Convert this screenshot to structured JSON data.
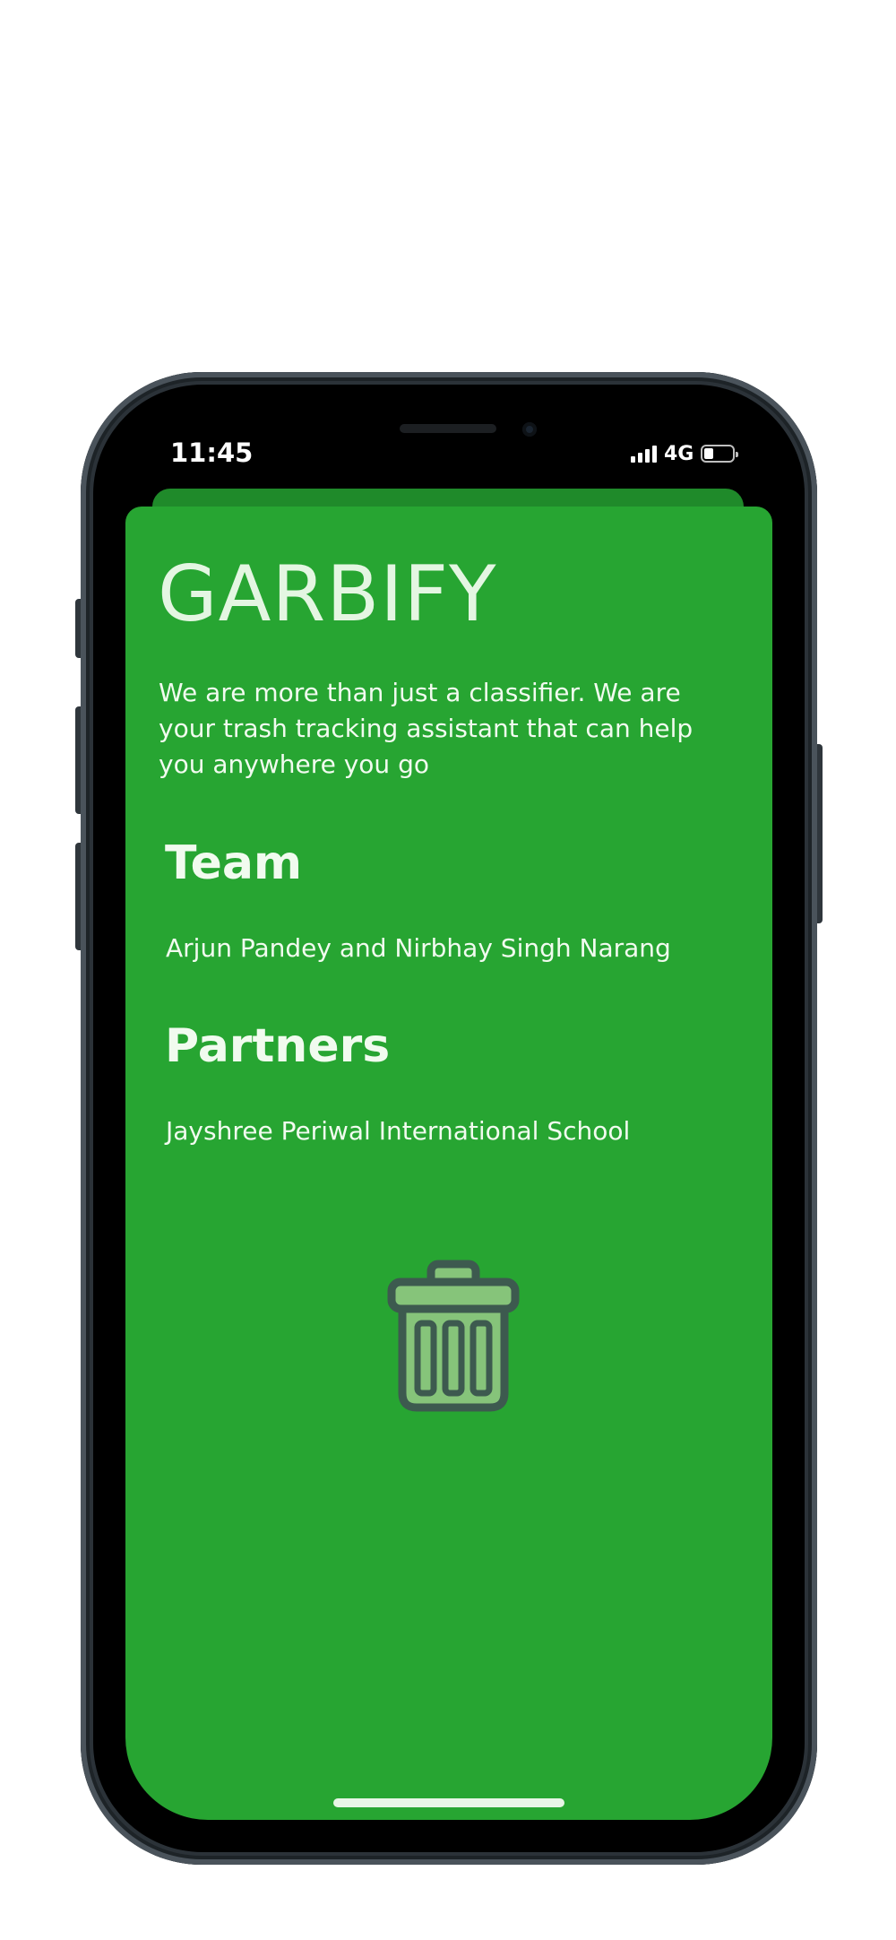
{
  "status_bar": {
    "time": "11:45",
    "network": "4G"
  },
  "app": {
    "title": "GARBIFY",
    "description": "We are more than just a classifier. We are your trash tracking assistant that can help you anywhere you go",
    "team": {
      "heading": "Team",
      "text": "Arjun Pandey and Nirbhay Singh Narang"
    },
    "partners": {
      "heading": "Partners",
      "text": "Jayshree Periwal International School"
    },
    "icon": "trash-can-icon"
  },
  "colors": {
    "card_background": "#27a532",
    "title_text": "#e4f6e2",
    "icon_dark": "#3d5a4f",
    "icon_light": "#86c47a"
  }
}
